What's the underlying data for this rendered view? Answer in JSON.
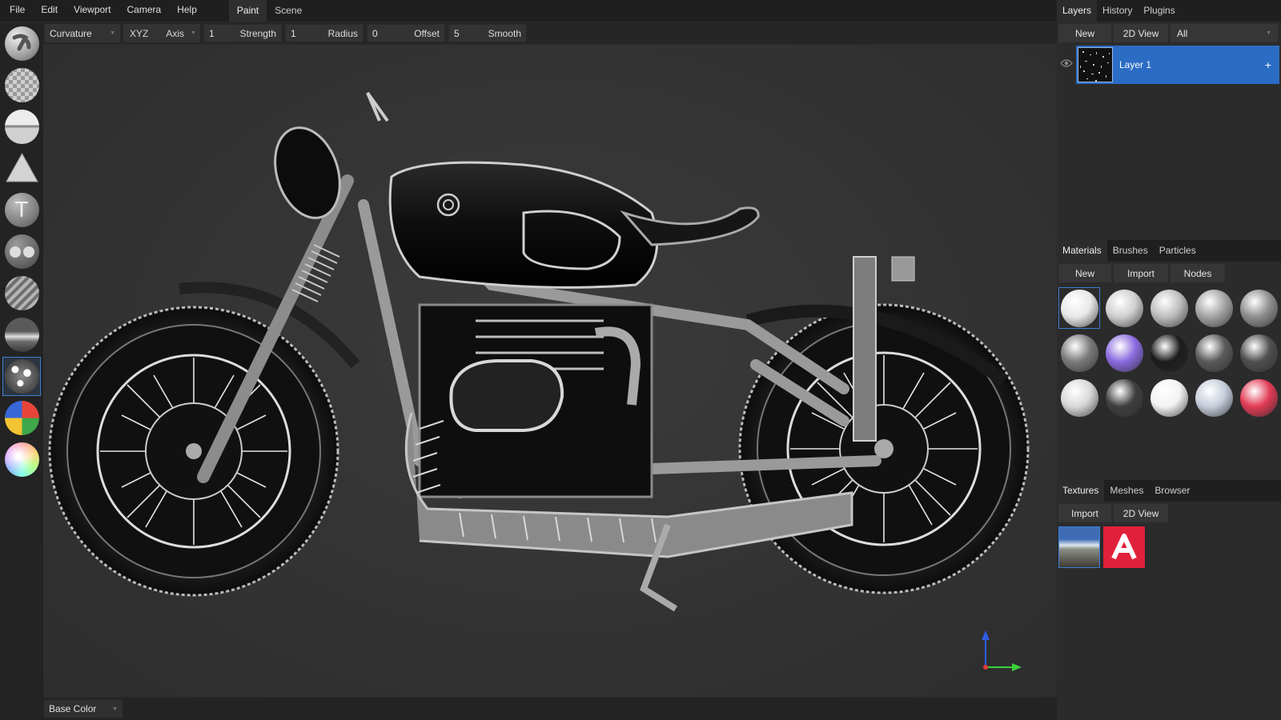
{
  "menu": {
    "items": [
      "File",
      "Edit",
      "Viewport",
      "Camera",
      "Help"
    ],
    "workspace_tabs": [
      "Paint",
      "Scene"
    ],
    "active_workspace": "Paint"
  },
  "toolbar": {
    "mask_mode": "Curvature",
    "mirror_axes": "XYZ",
    "axis_label": "Axis",
    "strength_value": "1",
    "strength_label": "Strength",
    "radius_value": "1",
    "radius_label": "Radius",
    "offset_value": "0",
    "offset_label": "Offset",
    "smooth_value": "5",
    "smooth_label": "Smooth"
  },
  "tools": [
    {
      "name": "brush-tool-icon"
    },
    {
      "name": "eraser-tool-icon"
    },
    {
      "name": "fill-tool-icon"
    },
    {
      "name": "decal-tool-icon"
    },
    {
      "name": "text-tool-icon"
    },
    {
      "name": "clone-tool-icon"
    },
    {
      "name": "blur-tool-icon"
    },
    {
      "name": "smudge-tool-icon"
    },
    {
      "name": "particle-tool-icon"
    },
    {
      "name": "colorid-picker-tool-icon"
    },
    {
      "name": "material-picker-tool-icon"
    }
  ],
  "active_tool_index": 8,
  "status": {
    "channel": "Base Color"
  },
  "layers_panel": {
    "tabs": [
      "Layers",
      "History",
      "Plugins"
    ],
    "active_tab": "Layers",
    "new_label": "New",
    "view2d_label": "2D View",
    "filter_value": "All",
    "layers": [
      {
        "name": "Layer 1",
        "visible": true
      }
    ]
  },
  "materials_panel": {
    "tabs": [
      "Materials",
      "Brushes",
      "Particles"
    ],
    "active_tab": "Materials",
    "new_label": "New",
    "import_label": "Import",
    "nodes_label": "Nodes",
    "swatches": [
      {
        "name": "material-white-glossy",
        "color": "#e8e8e8"
      },
      {
        "name": "material-light-grey",
        "color": "#cfcfcf"
      },
      {
        "name": "material-grey",
        "color": "#bdbdbd"
      },
      {
        "name": "material-mid-grey",
        "color": "#a3a3a3"
      },
      {
        "name": "material-dark-grey",
        "color": "#8e8e8e"
      },
      {
        "name": "material-chrome-dark",
        "color": "#7a7a7a"
      },
      {
        "name": "material-purple",
        "color": "#8a6be0"
      },
      {
        "name": "material-black-glossy",
        "color": "#1c1c1c"
      },
      {
        "name": "material-chrome-1",
        "color": "#5a5a5a"
      },
      {
        "name": "material-chrome-2",
        "color": "#4f4f4f"
      },
      {
        "name": "material-glass",
        "color": "#d8d8d8"
      },
      {
        "name": "material-dark-chrome",
        "color": "#3f3f3f"
      },
      {
        "name": "material-white-matte",
        "color": "#f2f2f2"
      },
      {
        "name": "material-sky-mirror",
        "color": "#c5cdda"
      },
      {
        "name": "material-red-white",
        "color": "#e23b55"
      }
    ],
    "selected_index": 0
  },
  "textures_panel": {
    "tabs": [
      "Textures",
      "Meshes",
      "Browser"
    ],
    "active_tab": "Textures",
    "import_label": "Import",
    "view2d_label": "2D View",
    "items": [
      {
        "name": "texture-envmap-thumbnail",
        "color": "#5a7aa8"
      },
      {
        "name": "texture-logo-thumbnail",
        "color": "#e1213c"
      }
    ],
    "selected_index": 0
  },
  "colors": {
    "accent": "#3d7fd3",
    "layer_selected": "#2b6cc4",
    "axis_x": "#e23a3a",
    "axis_y": "#3ad13a",
    "axis_z": "#2f5be0"
  }
}
